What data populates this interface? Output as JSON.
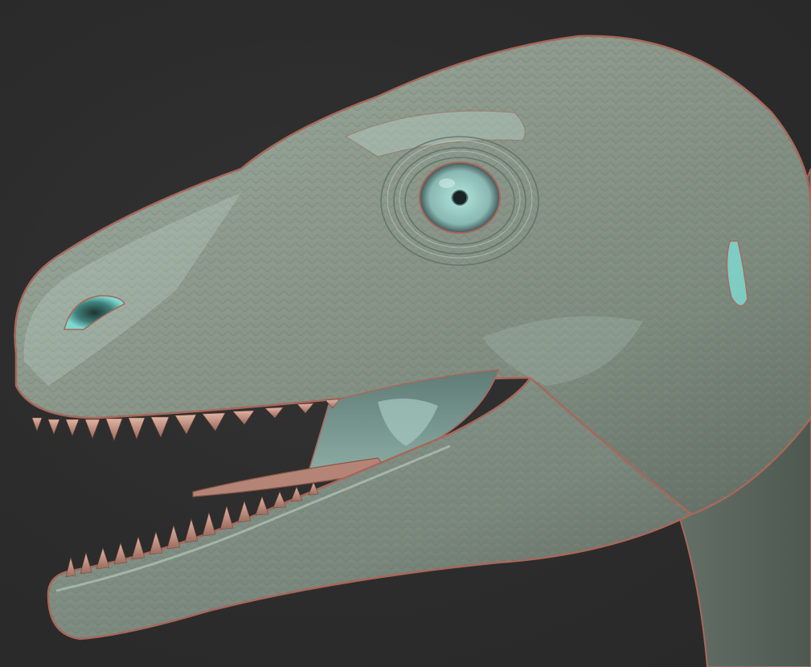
{
  "viewport": {
    "background": "#2b2b2b",
    "subject": "dinosaur-head-sculpt"
  },
  "material": {
    "base": "#8f9a8c",
    "highlight": "#cfe3dc",
    "rim": "#a9675a",
    "cavity": "#2f3e3e",
    "specular_cyan": "#7fd8cf",
    "teeth": "#c99a88",
    "mouth_interior": "#6f8f88"
  }
}
